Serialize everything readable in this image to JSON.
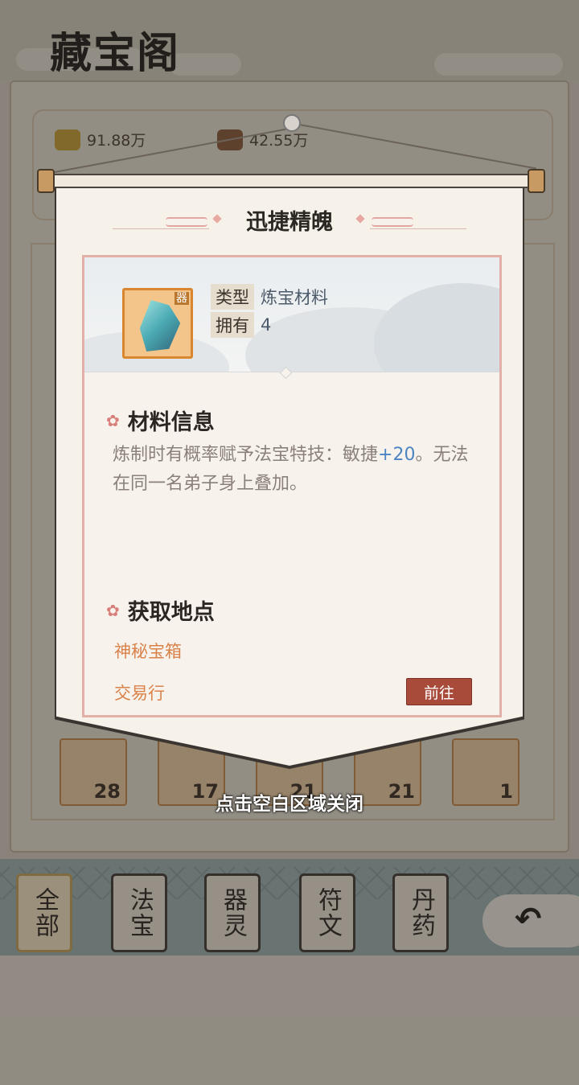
{
  "background": {
    "title": "藏宝阁",
    "resources": [
      {
        "icon": "gold-ingot-icon",
        "value": "91.88万"
      },
      {
        "icon": "ore-icon",
        "value": "42.55万"
      }
    ],
    "slot_counts": [
      "28",
      "17",
      "21",
      "21",
      "1"
    ],
    "tabs": [
      {
        "label": "全部",
        "active": true
      },
      {
        "label": "法宝",
        "active": false
      },
      {
        "label": "器灵",
        "active": false
      },
      {
        "label": "符文",
        "active": false
      },
      {
        "label": "丹药",
        "active": false
      }
    ]
  },
  "modal": {
    "title": "迅捷精魄",
    "item": {
      "icon": "crystal-shard-icon",
      "type_label": "类型",
      "type_value": "炼宝材料",
      "owned_label": "拥有",
      "owned_value": "4"
    },
    "info": {
      "heading": "材料信息",
      "desc_before": "炼制时有概率赋予法宝特技：敏捷",
      "desc_highlight": "+20",
      "desc_after": "。无法在同一名弟子身上叠加。"
    },
    "source": {
      "heading": "获取地点",
      "locations": [
        "神秘宝箱",
        "交易行"
      ],
      "go_label": "前往"
    },
    "close_hint": "点击空白区域关闭"
  },
  "colors": {
    "accent_orange": "#d9824a",
    "button_red": "#a84b3a",
    "highlight_blue": "#4c84c4"
  }
}
